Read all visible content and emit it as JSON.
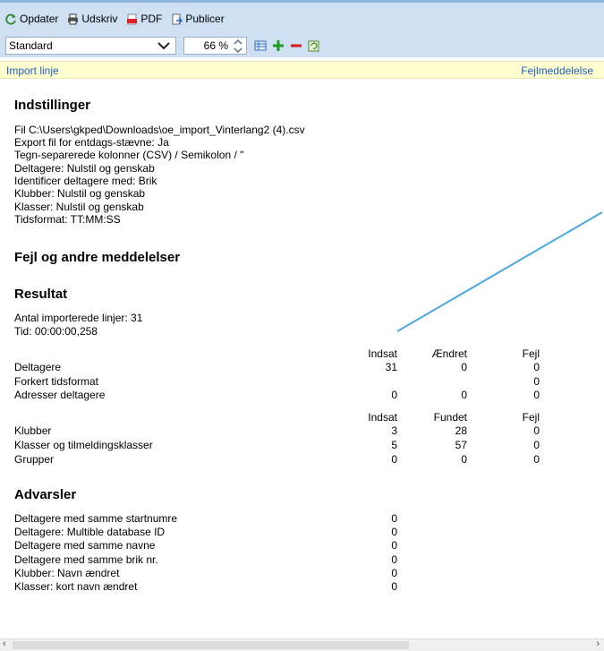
{
  "toolbar": {
    "refresh_label": "Opdater",
    "print_label": "Udskriv",
    "pdf_label": "PDF",
    "publish_label": "Publicer",
    "template_value": "Standard",
    "zoom_value": "66 %"
  },
  "links": {
    "left": "Import linje",
    "right": "Fejlmeddelelse"
  },
  "settings": {
    "heading": "Indstillinger",
    "lines": [
      "Fil C:\\Users\\gkped\\Downloads\\oe_import_Vinterlang2 (4).csv",
      "Export fil for entdags-stævne: Ja",
      "Tegn-separerede kolonner (CSV) / Semikolon / \"",
      "Deltagere: Nulstil og genskab",
      "Identificer deltagere med: Brik",
      "Klubber: Nulstil og genskab",
      "Klasser: Nulstil og genskab",
      "Tidsformat: TT:MM:SS"
    ]
  },
  "errors": {
    "heading": "Fejl og andre meddelelser"
  },
  "result": {
    "heading": "Resultat",
    "lines": [
      "Antal importerede linjer: 31",
      "Tid: 00:00:00,258"
    ],
    "table1": {
      "headers": [
        "Indsat",
        "Ændret",
        "Fejl"
      ],
      "rows": [
        {
          "label": "Deltagere",
          "c1": "31",
          "c2": "0",
          "c3": "0"
        },
        {
          "label": "Forkert tidsformat",
          "c1": "",
          "c2": "",
          "c3": "0"
        },
        {
          "label": "Adresser deltagere",
          "c1": "0",
          "c2": "0",
          "c3": "0"
        }
      ]
    },
    "table2": {
      "headers": [
        "Indsat",
        "Fundet",
        "Fejl"
      ],
      "rows": [
        {
          "label": "Klubber",
          "c1": "3",
          "c2": "28",
          "c3": "0"
        },
        {
          "label": "Klasser og tilmeldingsklasser",
          "c1": "5",
          "c2": "57",
          "c3": "0"
        },
        {
          "label": "Grupper",
          "c1": "0",
          "c2": "0",
          "c3": "0"
        }
      ]
    }
  },
  "warnings": {
    "heading": "Advarsler",
    "rows": [
      {
        "label": "Deltagere med samme startnumre",
        "value": "0"
      },
      {
        "label": "Deltagere: Multible database ID",
        "value": "0"
      },
      {
        "label": "Deltagere med samme navne",
        "value": "0"
      },
      {
        "label": "Deltagere med samme brik nr.",
        "value": "0"
      },
      {
        "label": "Klubber: Navn ændret",
        "value": "0"
      },
      {
        "label": "Klasser: kort navn ændret",
        "value": "0"
      }
    ]
  },
  "colors": {
    "toolbar_bg": "#cfe0f3",
    "link": "#1f5fbf",
    "linkbar_bg": "#ffffd0",
    "line": "#4aa8e0"
  }
}
